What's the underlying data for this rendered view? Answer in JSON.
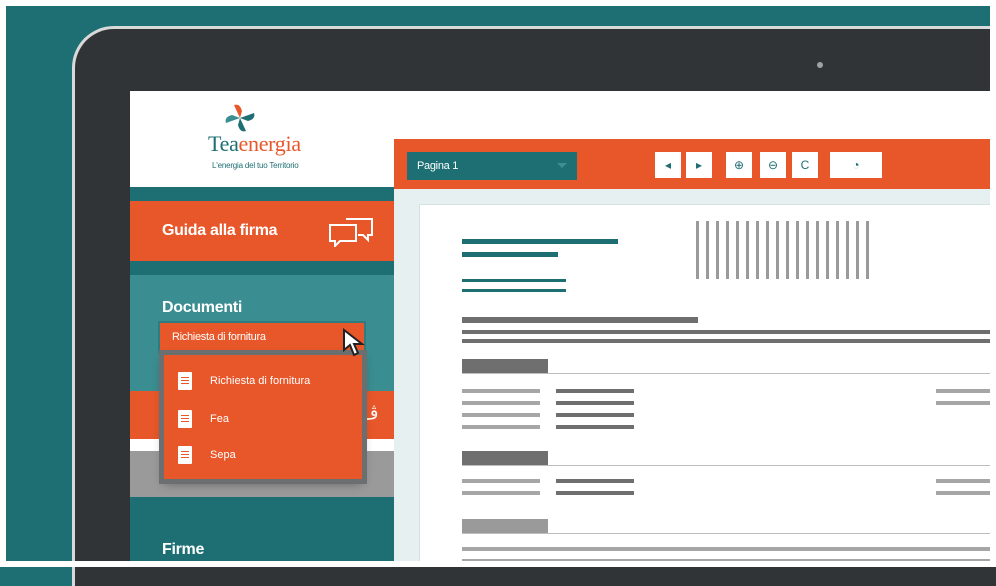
{
  "brand": {
    "name_part1": "Tea",
    "name_part2": "energia",
    "tagline": "L'energia del tuo Territorio",
    "color_primary": "#1d6f73",
    "color_accent": "#e8572a"
  },
  "sidebar": {
    "guida_label": "Guida alla firma",
    "guida_icon": "chat-bubbles-icon",
    "documenti_title": "Documenti",
    "documenti_select_value": "Richiesta di fornitura",
    "documenti_options": [
      {
        "label": "Richiesta di fornitura",
        "icon": "document-icon"
      },
      {
        "label": "Fea",
        "icon": "document-icon"
      },
      {
        "label": "Sepa",
        "icon": "document-icon"
      }
    ],
    "firme_label": "Firme"
  },
  "toolbar": {
    "page_select_value": "Pagina 1",
    "buttons": [
      {
        "name": "prev-page",
        "icon": "◂"
      },
      {
        "name": "next-page",
        "icon": "▸"
      },
      {
        "name": "zoom-in",
        "icon": "⊕"
      },
      {
        "name": "zoom-out",
        "icon": "⊖"
      },
      {
        "name": "rotate",
        "icon": "C"
      },
      {
        "name": "timer",
        "icon": "◔"
      }
    ]
  }
}
